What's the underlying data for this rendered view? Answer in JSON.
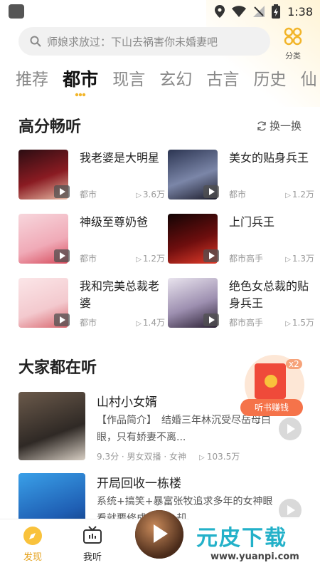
{
  "status": {
    "time": "1:38"
  },
  "search": {
    "placeholder": "师娘求放过：下山去祸害你未婚妻吧"
  },
  "category": {
    "label": "分类"
  },
  "tabs": [
    "推荐",
    "都市",
    "现言",
    "玄幻",
    "古言",
    "历史",
    "仙"
  ],
  "active_tab": "都市",
  "high_score": {
    "title": "高分畅听",
    "refresh_label": "换一换",
    "books": [
      {
        "title": "我老婆是大明星",
        "tag": "都市",
        "plays": "3.6万"
      },
      {
        "title": "美女的贴身兵王",
        "tag": "都市",
        "plays": "1.2万"
      },
      {
        "title": "神级至尊奶爸",
        "tag": "都市",
        "plays": "1.2万"
      },
      {
        "title": "上门兵王",
        "tag": "都市高手",
        "plays": "1.3万"
      },
      {
        "title": "我和完美总裁老婆",
        "tag": "都市",
        "plays": "1.4万"
      },
      {
        "title": "绝色女总裁的贴身兵王",
        "tag": "都市高手",
        "plays": "1.5万"
      }
    ]
  },
  "everyone": {
    "title": "大家都在听",
    "books": [
      {
        "title": "山村小女婿",
        "desc": "【作品简介】　结婚三年林沉受尽岳母白眼，只有娇妻不离...",
        "meta": "9.3分 · 男女双播 · 女神",
        "plays": "103.5万"
      },
      {
        "title": "开局回收一栋楼",
        "desc": "系统+搞笑+暴富张牧追求多年的女神眼看就要修成正果，却",
        "meta": "",
        "plays": ""
      }
    ]
  },
  "floating": {
    "label": "听书赚钱",
    "badge": "x2"
  },
  "bottom_nav": {
    "discover": "发现",
    "listened": "我听"
  },
  "watermark": {
    "main": "元皮下载",
    "url": "www.yuanpi.com"
  },
  "colors": {
    "accent": "#f9c23c",
    "red": "#ef4a3a",
    "orange": "#f5734a"
  }
}
